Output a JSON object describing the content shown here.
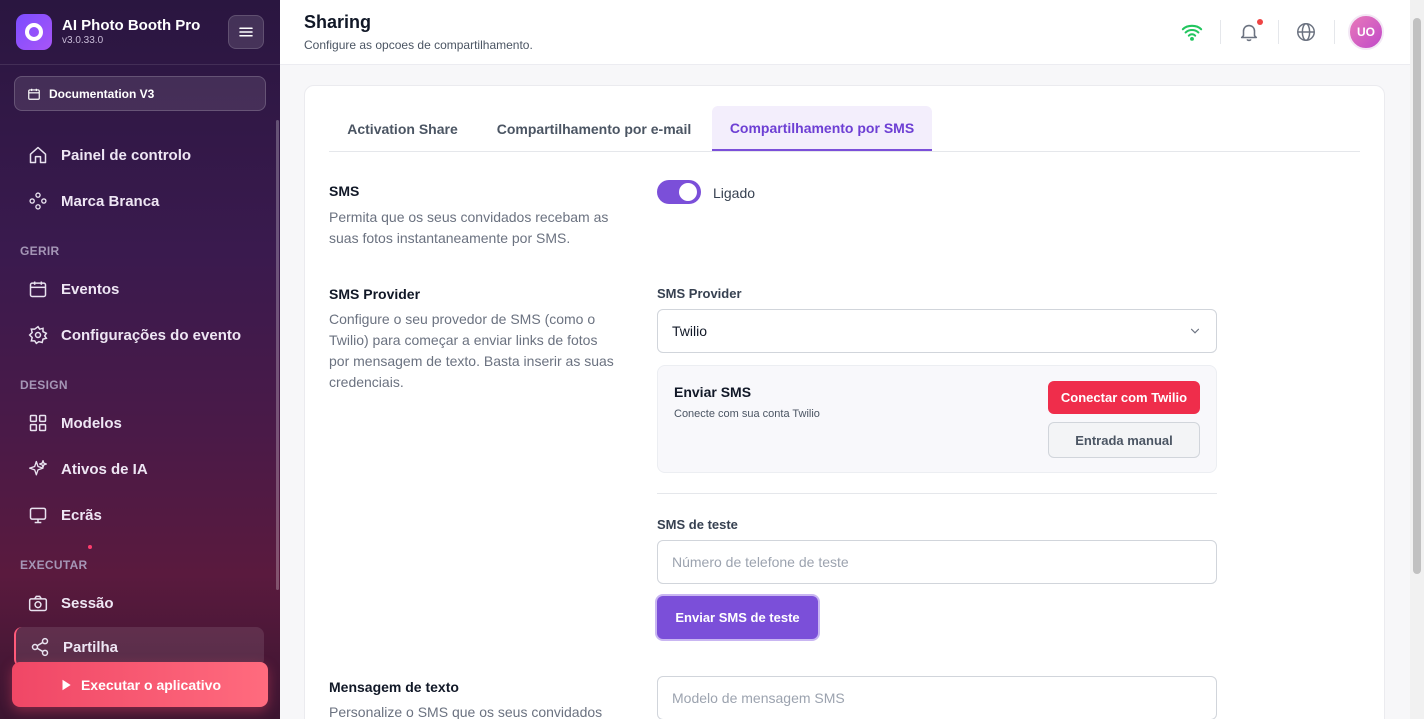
{
  "brand": {
    "name": "AI Photo Booth Pro",
    "version": "v3.0.33.0"
  },
  "sidebar": {
    "doc_button": "Documentation V3",
    "items": [
      {
        "label": "Painel de controlo",
        "icon": "home-icon"
      },
      {
        "label": "Marca Branca",
        "icon": "diamond-nodes-icon"
      },
      {
        "label": "Eventos",
        "icon": "calendar-icon"
      },
      {
        "label": "Configurações do evento",
        "icon": "gear-icon"
      },
      {
        "label": "Modelos",
        "icon": "grid-icon"
      },
      {
        "label": "Ativos de IA",
        "icon": "sparkles-icon"
      },
      {
        "label": "Ecrãs",
        "icon": "monitor-icon"
      },
      {
        "label": "Sessão",
        "icon": "camera-icon"
      },
      {
        "label": "Partilha",
        "icon": "share-icon"
      }
    ],
    "sections": {
      "manage": "GERIR",
      "design": "DESIGN",
      "run": "EXECUTAR"
    },
    "run_button": "Executar o aplicativo"
  },
  "header": {
    "title": "Sharing",
    "subtitle": "Configure as opcoes de compartilhamento.",
    "avatar": "UO"
  },
  "tabs": [
    {
      "label": "Activation Share"
    },
    {
      "label": "Compartilhamento por e-mail"
    },
    {
      "label": "Compartilhamento por SMS"
    }
  ],
  "sms": {
    "title": "SMS",
    "desc": "Permita que os seus convidados recebam as suas fotos instantaneamente por SMS.",
    "toggle_label": "Ligado",
    "enabled": true
  },
  "provider": {
    "title": "SMS Provider",
    "desc": "Configure o seu provedor de SMS (como o Twilio) para começar a enviar links de fotos por mensagem de texto. Basta inserir as suas credenciais.",
    "field_label": "SMS Provider",
    "selected": "Twilio",
    "box_title": "Enviar SMS",
    "box_sub": "Conecte com sua conta Twilio",
    "connect_button": "Conectar com Twilio",
    "manual_button": "Entrada manual"
  },
  "test": {
    "label": "SMS de teste",
    "placeholder": "Número de telefone de teste",
    "button": "Enviar SMS de teste"
  },
  "message": {
    "title": "Mensagem de texto",
    "desc": "Personalize o SMS que os seus convidados",
    "placeholder": "Modelo de mensagem SMS"
  },
  "colors": {
    "accent": "#7b4fd9",
    "danger": "#ef2d4b",
    "wifi": "#22c55e"
  }
}
